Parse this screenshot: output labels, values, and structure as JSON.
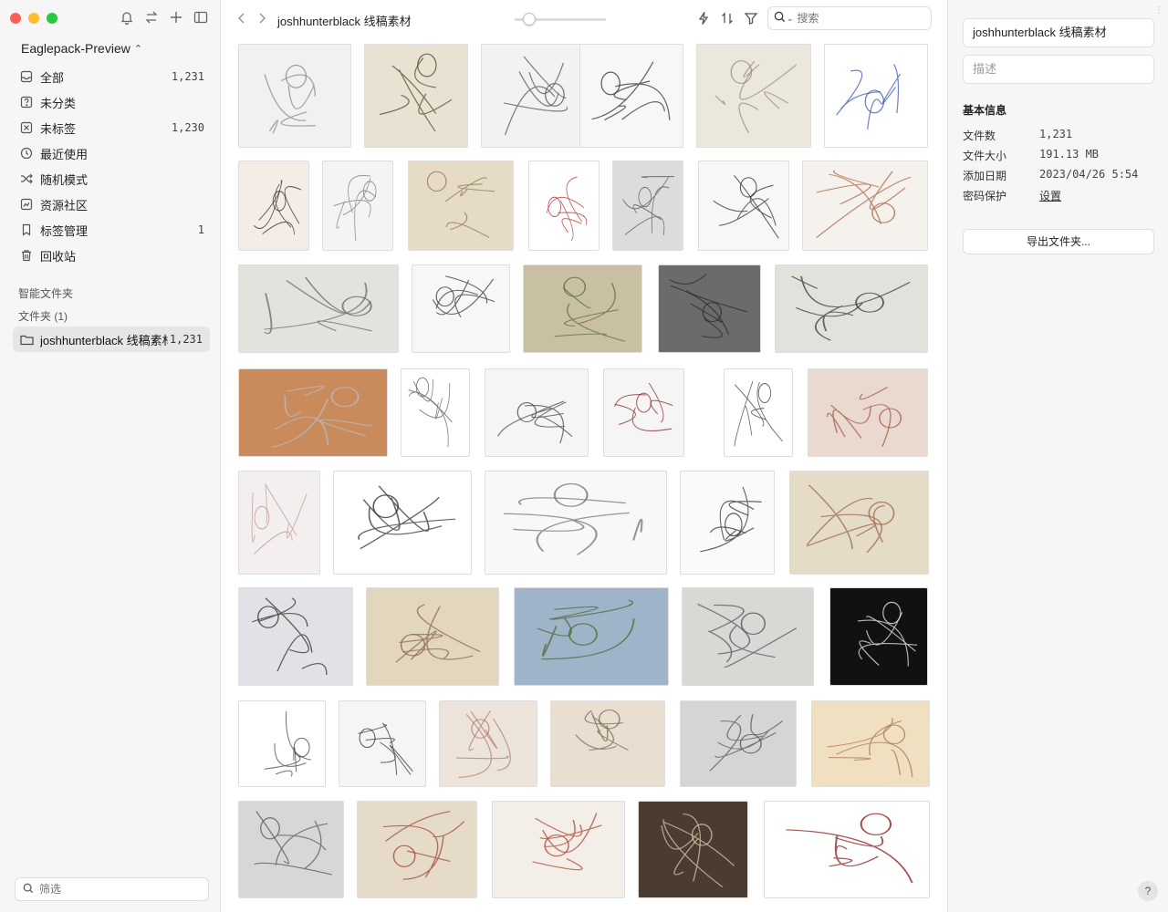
{
  "window": {
    "traffic_colors": [
      "#ff5f57",
      "#febc2e",
      "#28c840"
    ]
  },
  "sidebar": {
    "library_name": "Eaglepack-Preview",
    "items": [
      {
        "label": "全部",
        "count": "1,231",
        "icon": "inbox-icon"
      },
      {
        "label": "未分类",
        "count": "",
        "icon": "question-box-icon"
      },
      {
        "label": "未标签",
        "count": "1,230",
        "icon": "untagged-icon"
      },
      {
        "label": "最近使用",
        "count": "",
        "icon": "clock-icon"
      },
      {
        "label": "随机模式",
        "count": "",
        "icon": "shuffle-icon"
      },
      {
        "label": "资源社区",
        "count": "",
        "icon": "community-icon"
      },
      {
        "label": "标签管理",
        "count": "1",
        "icon": "bookmark-icon"
      },
      {
        "label": "回收站",
        "count": "",
        "icon": "trash-icon"
      }
    ],
    "smart_folders_label": "智能文件夹",
    "folders_label": "文件夹 (1)",
    "folder": {
      "label": "joshhunterblack 线稿素材",
      "count": "1,231"
    },
    "filter_placeholder": "筛选"
  },
  "toolbar": {
    "folder_title": "joshhunterblack 线稿素材",
    "zoom_level": 0.12,
    "search_placeholder": "搜索"
  },
  "inspector": {
    "name": "joshhunterblack 线稿素材",
    "description_placeholder": "描述",
    "section_title": "基本信息",
    "rows": [
      {
        "key": "文件数",
        "value": "1,231"
      },
      {
        "key": "文件大小",
        "value": "191.13 MB"
      },
      {
        "key": "添加日期",
        "value": "2023/04/26 5:54"
      },
      {
        "key": "密码保护",
        "value": "设置"
      }
    ],
    "export_label": "导出文件夹...",
    "help_label": "?"
  },
  "thumbnails": [
    {
      "name": "running-figure-sketch",
      "tone": "#f1f1ef",
      "ink": "#8a8a8a"
    },
    {
      "name": "cartoon-tanks-soldiers",
      "tone": "#e8e2d2",
      "ink": "#5a4a2e"
    },
    {
      "name": "face-sketch",
      "tone": "#f2f2f0",
      "ink": "#555555"
    },
    {
      "name": "character-heads-sheet",
      "tone": "#f7f7f7",
      "ink": "#333333"
    },
    {
      "name": "skull-faces-study",
      "tone": "#ebe7dc",
      "ink": "#9a9283"
    },
    {
      "name": "wizard-character",
      "tone": "#ffffff",
      "ink": "#3d5bb8"
    },
    {
      "name": "blonde-soldier",
      "tone": "#f3ede6",
      "ink": "#2b2320"
    },
    {
      "name": "crouching-figure",
      "tone": "#f4f4f4",
      "ink": "#777777"
    },
    {
      "name": "figure-studies-beige",
      "tone": "#e6dcc6",
      "ink": "#8c7b5a"
    },
    {
      "name": "red-coat-heroine",
      "tone": "#ffffff",
      "ink": "#b03028"
    },
    {
      "name": "dolphin-drawing",
      "tone": "#dcdcdc",
      "ink": "#555555"
    },
    {
      "name": "two-characters",
      "tone": "#f7f7f7",
      "ink": "#2e2e2e"
    },
    {
      "name": "elderly-characters",
      "tone": "#f5f1ec",
      "ink": "#b0654a"
    },
    {
      "name": "hand-studies",
      "tone": "#e4e2dc",
      "ink": "#6b6b66"
    },
    {
      "name": "old-man-face",
      "tone": "#f7f7f7",
      "ink": "#333333"
    },
    {
      "name": "sketchbook-heads",
      "tone": "#c9c0a4",
      "ink": "#5a6c44"
    },
    {
      "name": "dark-sketch-faces",
      "tone": "#6b6b6b",
      "ink": "#2a2a2a"
    },
    {
      "name": "spider-studies",
      "tone": "#e2e1dc",
      "ink": "#3a3a3a"
    },
    {
      "name": "white-sports-car",
      "tone": "#c98a5c",
      "ink": "#b9bcc2"
    },
    {
      "name": "stormtrooper",
      "tone": "#ffffff",
      "ink": "#555555"
    },
    {
      "name": "haunted-house-sketch",
      "tone": "#f5f5f5",
      "ink": "#444444"
    },
    {
      "name": "woman-with-sword",
      "tone": "#f5f5f5",
      "ink": "#8a2222"
    },
    {
      "name": "man-with-shapes",
      "tone": "#ffffff",
      "ink": "#333333"
    },
    {
      "name": "red-figure-studies",
      "tone": "#e9d9cf",
      "ink": "#a05a4a"
    },
    {
      "name": "notebook-man-sketch",
      "tone": "#f3efee",
      "ink": "#c29a9a"
    },
    {
      "name": "pose-studies",
      "tone": "#ffffff",
      "ink": "#333333"
    },
    {
      "name": "dancer-poses",
      "tone": "#f8f8f8",
      "ink": "#777777"
    },
    {
      "name": "action-poses",
      "tone": "#fafafa",
      "ink": "#333333"
    },
    {
      "name": "figure-gesture-page",
      "tone": "#e5dcc8",
      "ink": "#9e6a50"
    },
    {
      "name": "woman-with-guns",
      "tone": "#e0e2e6",
      "ink": "#3a302c"
    },
    {
      "name": "heads-study-beige",
      "tone": "#e2d6bf",
      "ink": "#8c6a48"
    },
    {
      "name": "house-landscape",
      "tone": "#9fb4c8",
      "ink": "#4d6a38"
    },
    {
      "name": "sketchbook-figures",
      "tone": "#d8d8d5",
      "ink": "#555555"
    },
    {
      "name": "anatomy-figure",
      "tone": "#111111",
      "ink": "#eeeeee"
    },
    {
      "name": "robot-walker",
      "tone": "#ffffff",
      "ink": "#444444"
    },
    {
      "name": "tiger-sketch",
      "tone": "#f5f5f5",
      "ink": "#333333"
    },
    {
      "name": "horse-studies",
      "tone": "#ece4da",
      "ink": "#b07a6a"
    },
    {
      "name": "face-construction",
      "tone": "#e8dfd0",
      "ink": "#7a6450"
    },
    {
      "name": "feet-studies",
      "tone": "#d5d5d5",
      "ink": "#555555"
    },
    {
      "name": "warm-figure-studies",
      "tone": "#f1dfc2",
      "ink": "#a87a52"
    },
    {
      "name": "head-rotation-studies",
      "tone": "#d7d7d7",
      "ink": "#555555"
    },
    {
      "name": "portrait-studies-red",
      "tone": "#e6dac8",
      "ink": "#9e4a3a"
    },
    {
      "name": "man-reading-sketch",
      "tone": "#f3efe8",
      "ink": "#b04a3a"
    },
    {
      "name": "dark-sketchbook",
      "tone": "#4a3c30",
      "ink": "#d9c9a8"
    },
    {
      "name": "jafar-character-sheet",
      "tone": "#ffffff",
      "ink": "#8a1c1c"
    }
  ]
}
